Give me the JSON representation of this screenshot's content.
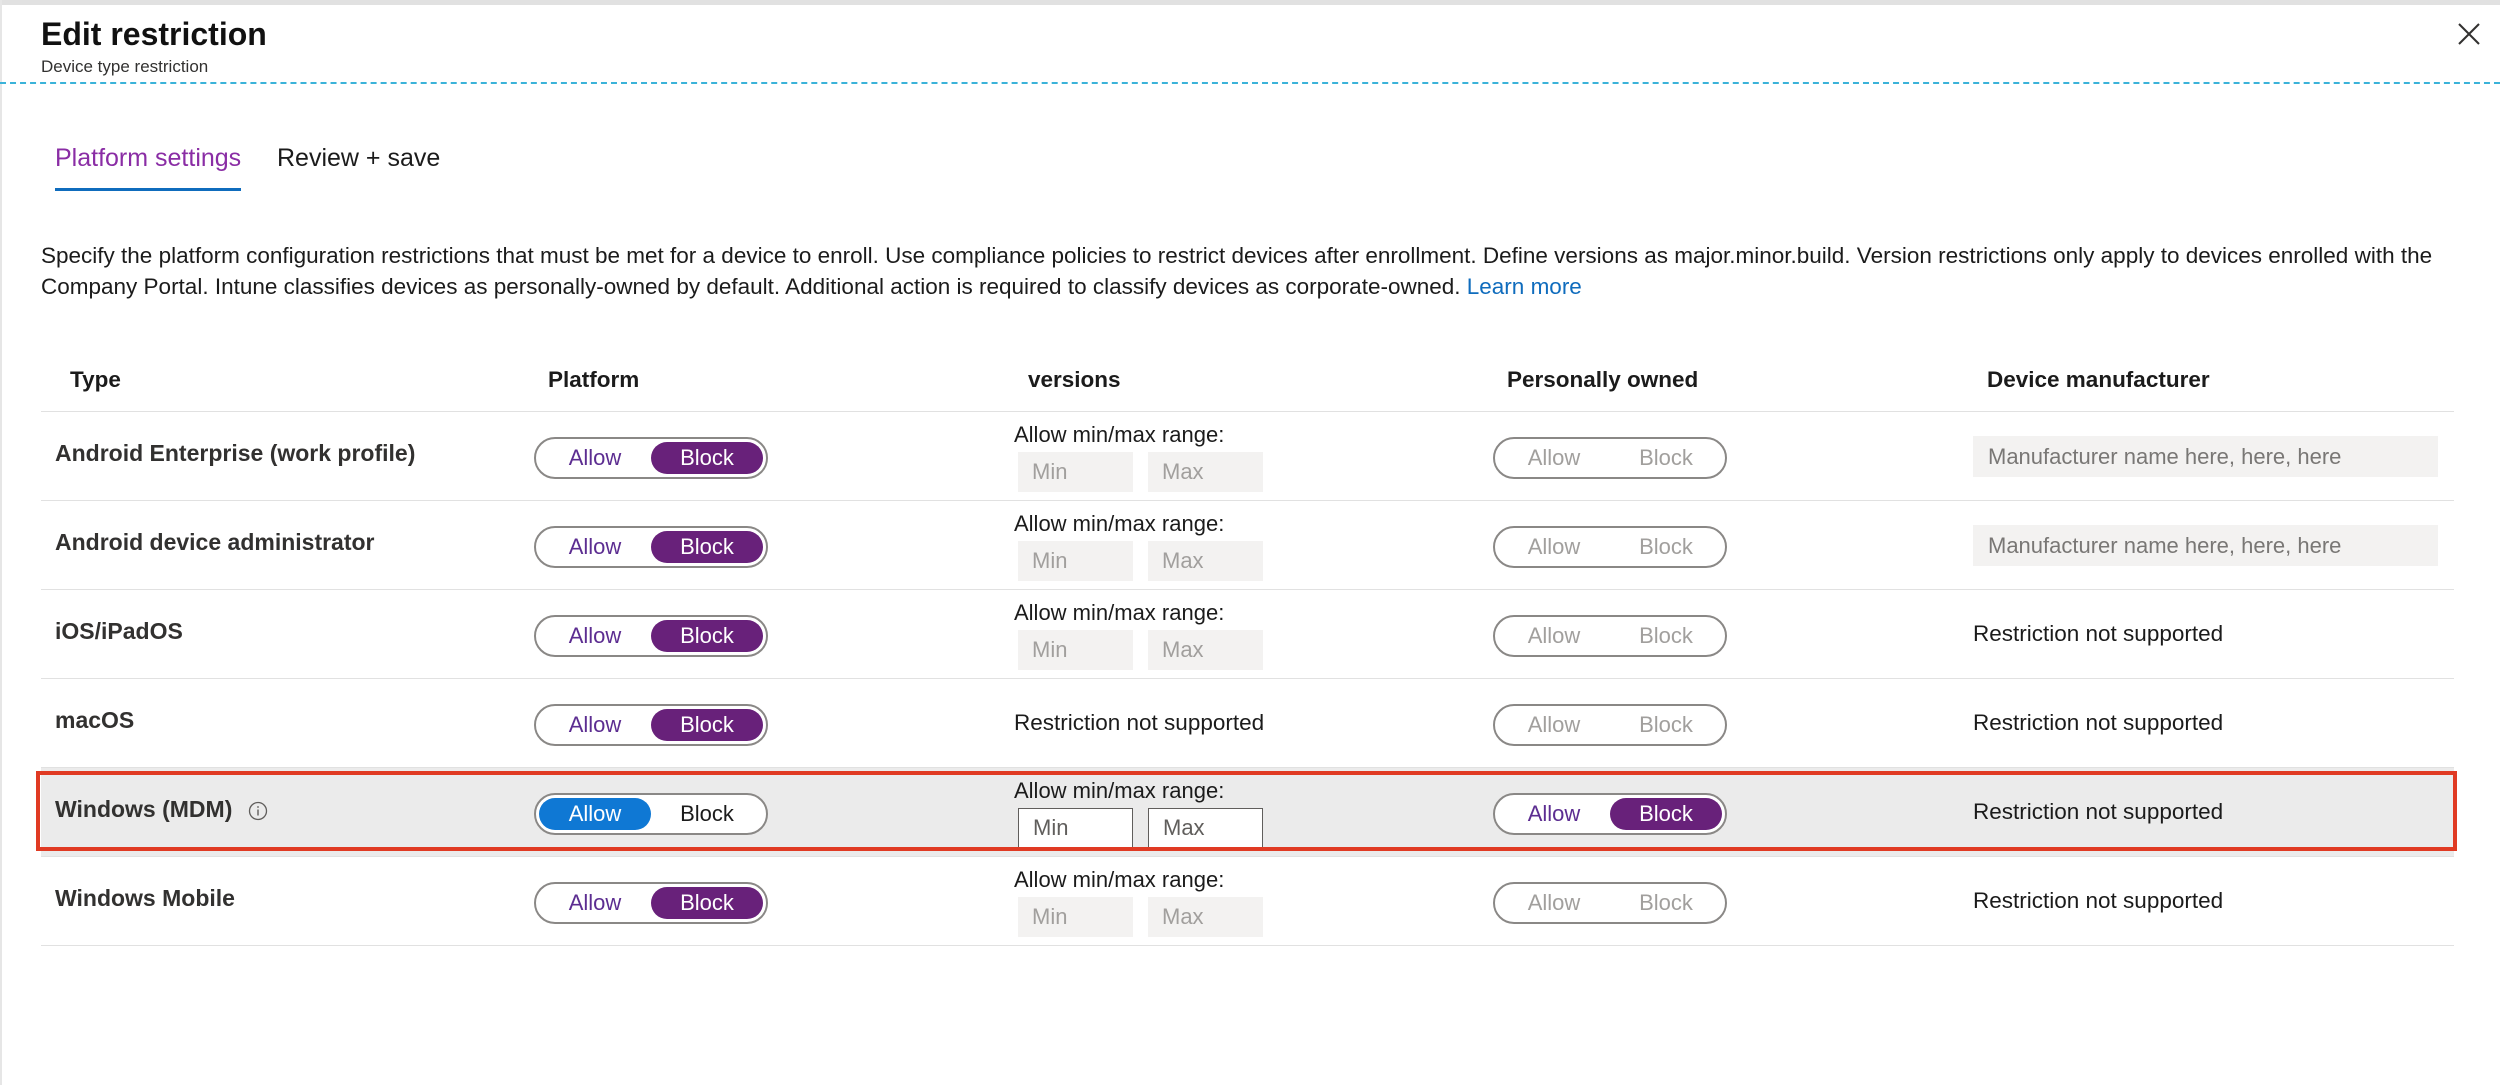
{
  "header": {
    "title": "Edit restriction",
    "subtitle": "Device type restriction"
  },
  "tabs": [
    {
      "label": "Platform settings",
      "active": true
    },
    {
      "label": "Review + save",
      "active": false
    }
  ],
  "description": {
    "text": "Specify the platform configuration restrictions that must be met for a device to enroll. Use compliance policies to restrict devices after enrollment. Define versions as major.minor.build. Version restrictions only apply to devices enrolled with the Company Portal. Intune classifies devices as personally-owned by default. Additional action is required to classify devices as corporate-owned.",
    "link": "Learn more"
  },
  "columns": {
    "type": "Type",
    "platform": "Platform",
    "versions": "versions",
    "personally_owned": "Personally owned",
    "manufacturer": "Device manufacturer"
  },
  "toggle_labels": {
    "allow": "Allow",
    "block": "Block"
  },
  "versions_range_label": "Allow min/max range:",
  "version_placeholders": {
    "min": "Min",
    "max": "Max"
  },
  "not_supported": "Restriction not supported",
  "manufacturer_placeholder": "Manufacturer name here, here, here",
  "rows": [
    {
      "type": "Android Enterprise (work profile)",
      "platform": "Block",
      "versions": "range",
      "personally_owned": "disabled",
      "manufacturer": "input"
    },
    {
      "type": "Android device administrator",
      "platform": "Block",
      "versions": "range",
      "personally_owned": "disabled",
      "manufacturer": "input"
    },
    {
      "type": "iOS/iPadOS",
      "platform": "Block",
      "versions": "range",
      "personally_owned": "disabled",
      "manufacturer": "not_supported"
    },
    {
      "type": "macOS",
      "platform": "Block",
      "versions": "not_supported",
      "personally_owned": "disabled",
      "manufacturer": "not_supported"
    },
    {
      "type": "Windows (MDM)",
      "platform": "Allow",
      "versions": "range_enabled",
      "personally_owned": "Block",
      "manufacturer": "not_supported",
      "highlighted": true,
      "info_icon": "info-icon"
    },
    {
      "type": "Windows Mobile",
      "platform": "Block",
      "versions": "range",
      "personally_owned": "disabled",
      "manufacturer": "not_supported"
    }
  ],
  "colors": {
    "accent_purple": "#68217a",
    "tab_active": "#8a2da5",
    "allow_blue": "#0f78d4",
    "link_blue": "#0f6cbd",
    "highlight_border": "#e03a23"
  }
}
